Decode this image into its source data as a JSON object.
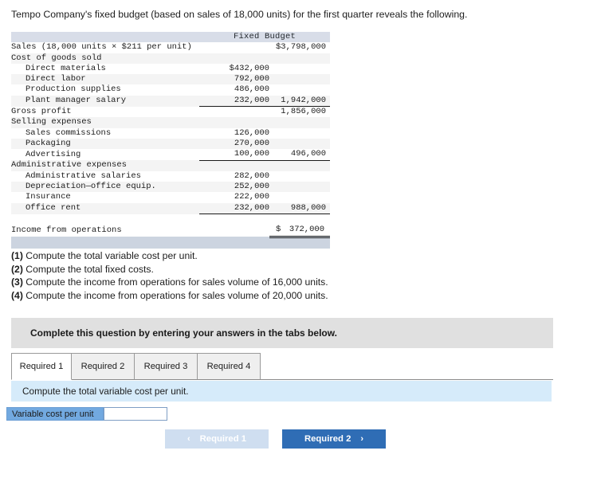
{
  "intro": "Tempo Company's fixed budget (based on sales of 18,000 units) for the first quarter reveals the following.",
  "table": {
    "header": "Fixed Budget",
    "rows": [
      {
        "label": "Sales (18,000 units × $211 per unit)",
        "indent": 0,
        "a": "",
        "b": "$3,798,000"
      },
      {
        "label": "Cost of goods sold",
        "indent": 0,
        "a": "",
        "b": ""
      },
      {
        "label": "Direct materials",
        "indent": 1,
        "a": "$432,000",
        "b": ""
      },
      {
        "label": "Direct labor",
        "indent": 1,
        "a": "792,000",
        "b": ""
      },
      {
        "label": "Production supplies",
        "indent": 1,
        "a": "486,000",
        "b": ""
      },
      {
        "label": "Plant manager salary",
        "indent": 1,
        "a": "232,000",
        "b": "1,942,000"
      },
      {
        "label": "Gross profit",
        "indent": 0,
        "a": "",
        "b": "1,856,000"
      },
      {
        "label": "Selling expenses",
        "indent": 0,
        "a": "",
        "b": ""
      },
      {
        "label": "Sales commissions",
        "indent": 1,
        "a": "126,000",
        "b": ""
      },
      {
        "label": "Packaging",
        "indent": 1,
        "a": "270,000",
        "b": ""
      },
      {
        "label": "Advertising",
        "indent": 1,
        "a": "100,000",
        "b": "496,000"
      },
      {
        "label": "Administrative expenses",
        "indent": 0,
        "a": "",
        "b": ""
      },
      {
        "label": "Administrative salaries",
        "indent": 1,
        "a": "282,000",
        "b": ""
      },
      {
        "label": "Depreciation—office equip.",
        "indent": 1,
        "a": "252,000",
        "b": ""
      },
      {
        "label": "Insurance",
        "indent": 1,
        "a": "222,000",
        "b": ""
      },
      {
        "label": "Office rent",
        "indent": 1,
        "a": "232,000",
        "b": "988,000"
      },
      {
        "label": "Income from operations",
        "indent": 0,
        "a": "",
        "b": "372,000",
        "currency": "$"
      }
    ]
  },
  "questions": [
    {
      "num": "(1)",
      "text": " Compute the total variable cost per unit."
    },
    {
      "num": "(2)",
      "text": " Compute the total fixed costs."
    },
    {
      "num": "(3)",
      "text": " Compute the income from operations for sales volume of 16,000 units."
    },
    {
      "num": "(4)",
      "text": " Compute the income from operations for sales volume of 20,000 units."
    }
  ],
  "banner": {
    "text": "Complete this question by entering your answers in the tabs below."
  },
  "tabs": [
    {
      "label": "Required 1",
      "active": true
    },
    {
      "label": "Required 2",
      "active": false
    },
    {
      "label": "Required 3",
      "active": false
    },
    {
      "label": "Required 4",
      "active": false
    }
  ],
  "requirement": {
    "text": "Compute the total variable cost per unit."
  },
  "answer": {
    "label": "Variable cost per unit",
    "value": "",
    "placeholder": ""
  },
  "nav": {
    "prev_label": "Required 1",
    "prev_chevron": "‹",
    "next_label": "Required 2",
    "next_chevron": "›"
  },
  "colors": {
    "table_header": "#d8dde8",
    "table_footer": "#ccd4e0",
    "banner": "#e0e0e0",
    "requirement_strip": "#d6ebfa",
    "answer_label": "#72a9e0",
    "next_button": "#2f6db5",
    "prev_button": "#cfdef0"
  }
}
